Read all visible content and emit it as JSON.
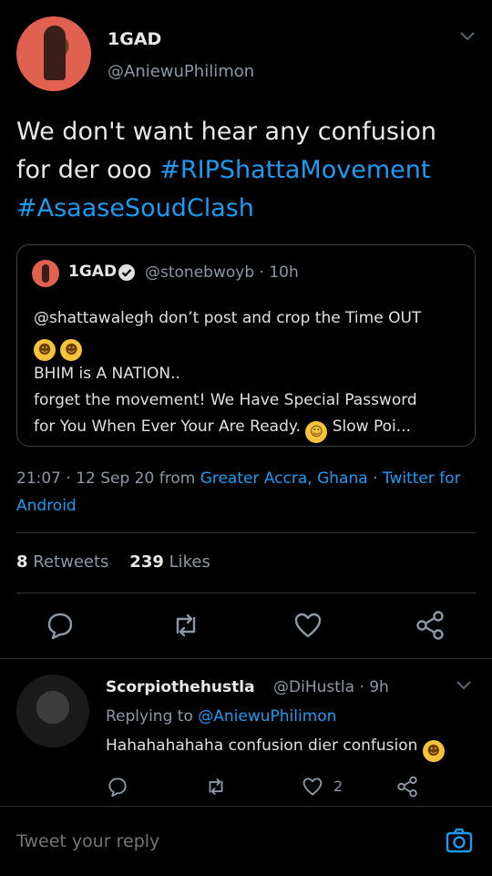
{
  "tweet": {
    "author_name": "1GAD",
    "author_handle": "@AniewuPhilimon",
    "text_line1": "We don't want hear any confusion",
    "text_line2_plain": "for der ooo ",
    "hashtag1": "#RIPShattaMovement",
    "hashtag2": "#AsaaseSoudClash"
  },
  "quote": {
    "name": "1GAD",
    "handle_time": "@stonebwoyb · 10h",
    "line1": "@shattawalegh don’t post and crop the Time OUT",
    "line3": "BHIM is A NATION..",
    "line4": "forget the movement! We Have Special Password",
    "line5a": "for You When Ever   Your Are Ready.",
    "line5b": "Slow Poi..."
  },
  "meta": {
    "time_date": "21:07 · 12 Sep 20 from ",
    "location": "Greater Accra, Ghana",
    "sep": " · ",
    "client": "Twitter for Android"
  },
  "stats": {
    "retweets_count": "8",
    "retweets_label": "Retweets",
    "likes_count": "239",
    "likes_label": "Likes"
  },
  "reply": {
    "name": "Scorpiothehustla",
    "handle_time": "@DiHustla · 9h",
    "replying_prefix": "Replying to ",
    "replying_to": "@AniewuPhilimon",
    "text": "Hahahahahaha confusion dier confusion",
    "like_count": "2"
  },
  "composer": {
    "placeholder": "Tweet your reply"
  },
  "icons": {
    "reply": "reply-icon",
    "retweet": "retweet-icon",
    "like": "heart-icon",
    "share": "share-icon",
    "camera": "camera-icon"
  },
  "colors": {
    "background": "#000000",
    "accent": "#1d9bf0",
    "muted": "#8b98a5"
  }
}
